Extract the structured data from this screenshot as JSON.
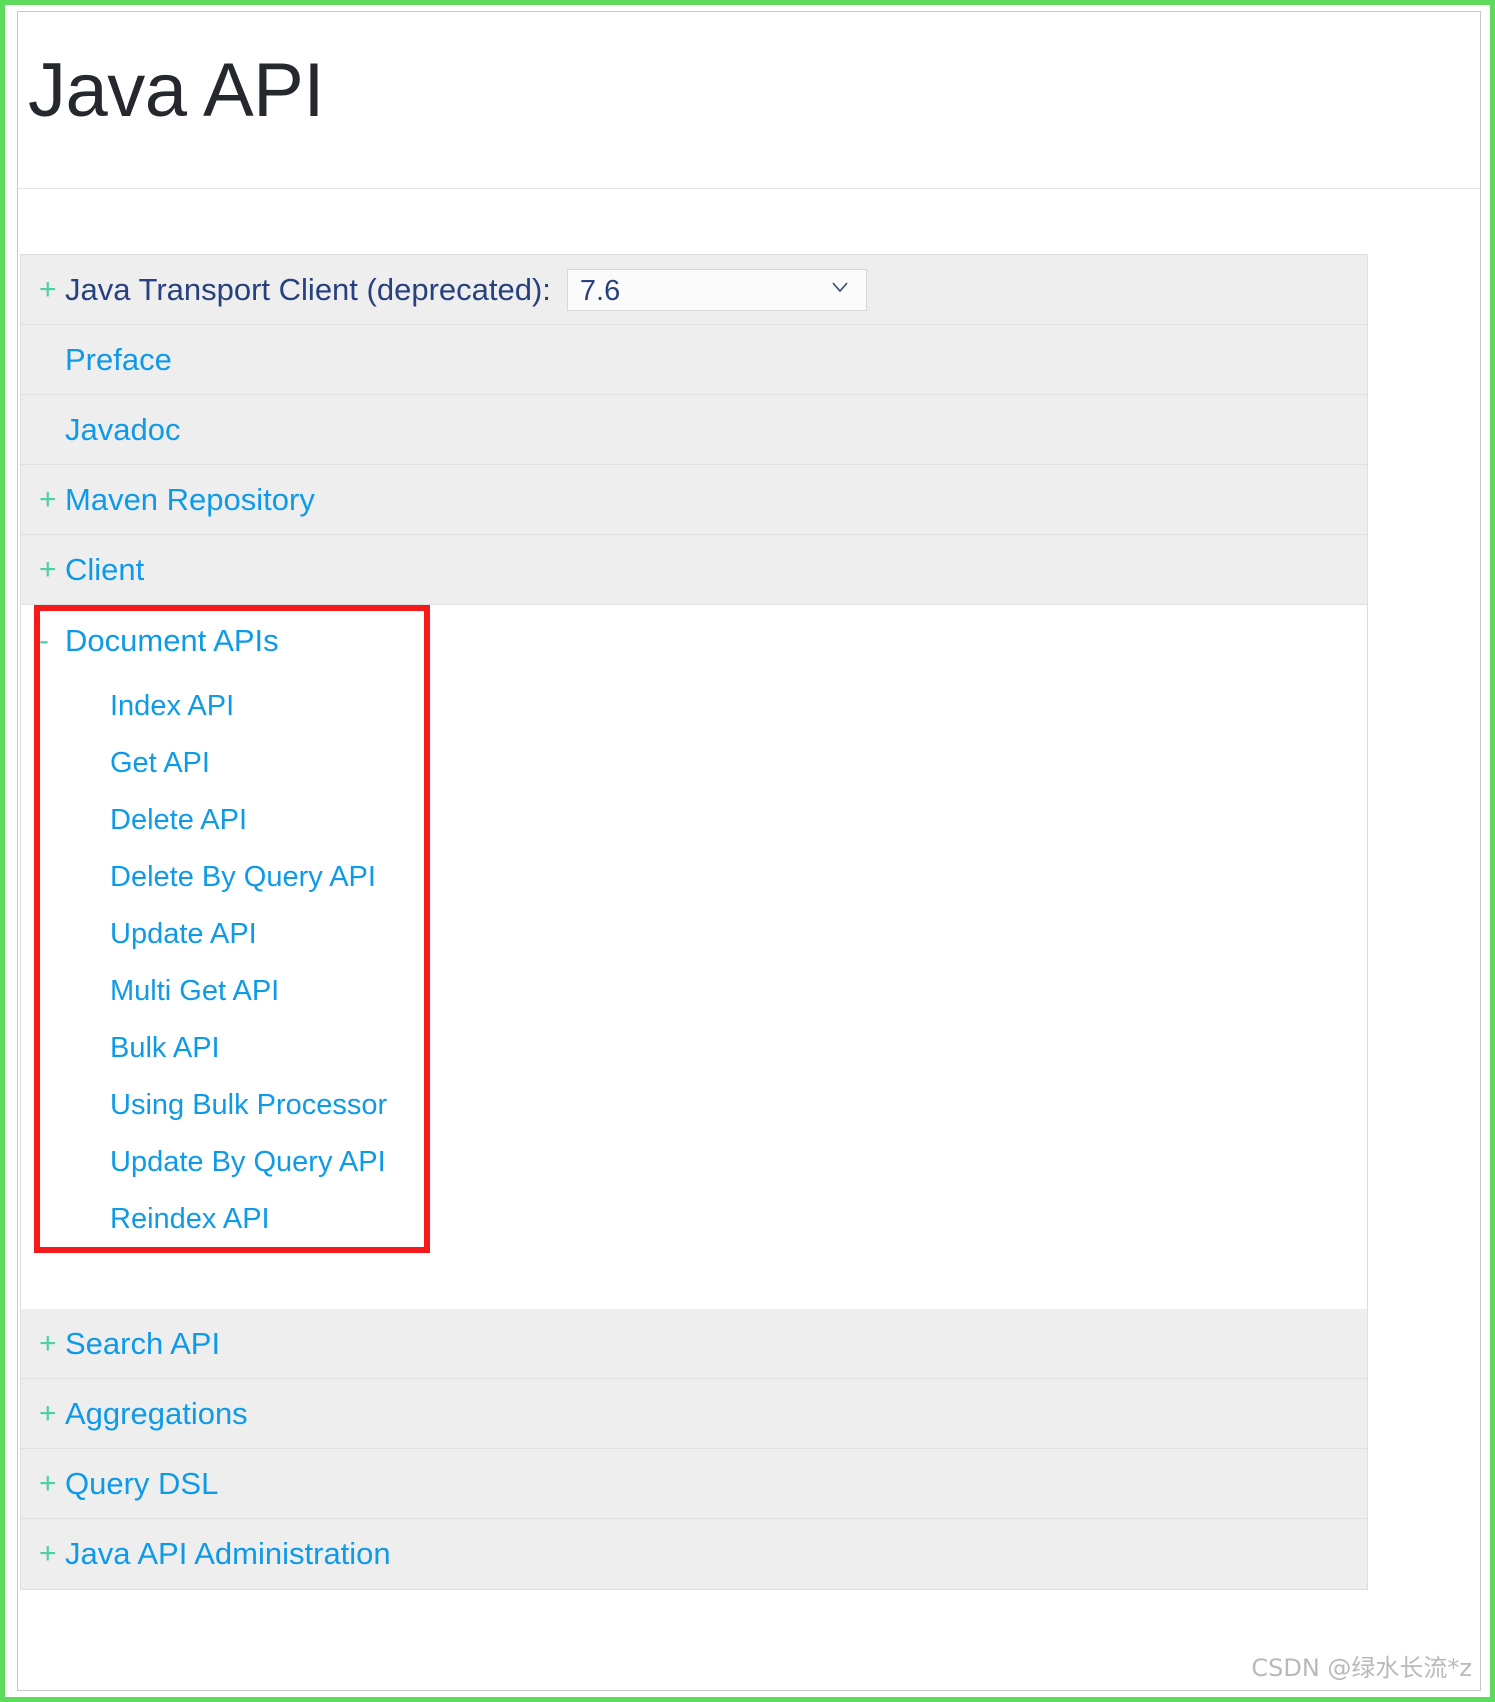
{
  "page": {
    "title": "Java API",
    "watermark": "CSDN @绿水长流*z"
  },
  "colors": {
    "frame_green": "#5ddb5d",
    "link_blue": "#0f9ae8",
    "deprecated_navy": "#27417e",
    "toggle_green": "#4fcfa3",
    "highlight_red": "#f51919",
    "row_gray": "#eeeeee",
    "title_dark": "#25292e"
  },
  "toc": {
    "version_select": {
      "label": "Java Transport Client (deprecated):",
      "toggle": "+",
      "selected": "7.6",
      "chevron_icon": "chevron-down-icon"
    },
    "items": [
      {
        "toggle": "",
        "label": "Preface"
      },
      {
        "toggle": "",
        "label": "Javadoc"
      },
      {
        "toggle": "+",
        "label": "Maven Repository"
      },
      {
        "toggle": "+",
        "label": "Client"
      }
    ],
    "document_apis": {
      "toggle": "-",
      "label": "Document APIs",
      "highlighted": true,
      "children": [
        "Index API",
        "Get API",
        "Delete API",
        "Delete By Query API",
        "Update API",
        "Multi Get API",
        "Bulk API",
        "Using Bulk Processor",
        "Update By Query API",
        "Reindex API"
      ]
    },
    "items_after": [
      {
        "toggle": "+",
        "label": "Search API"
      },
      {
        "toggle": "+",
        "label": "Aggregations"
      },
      {
        "toggle": "+",
        "label": "Query DSL"
      },
      {
        "toggle": "+",
        "label": "Java API Administration"
      }
    ]
  }
}
